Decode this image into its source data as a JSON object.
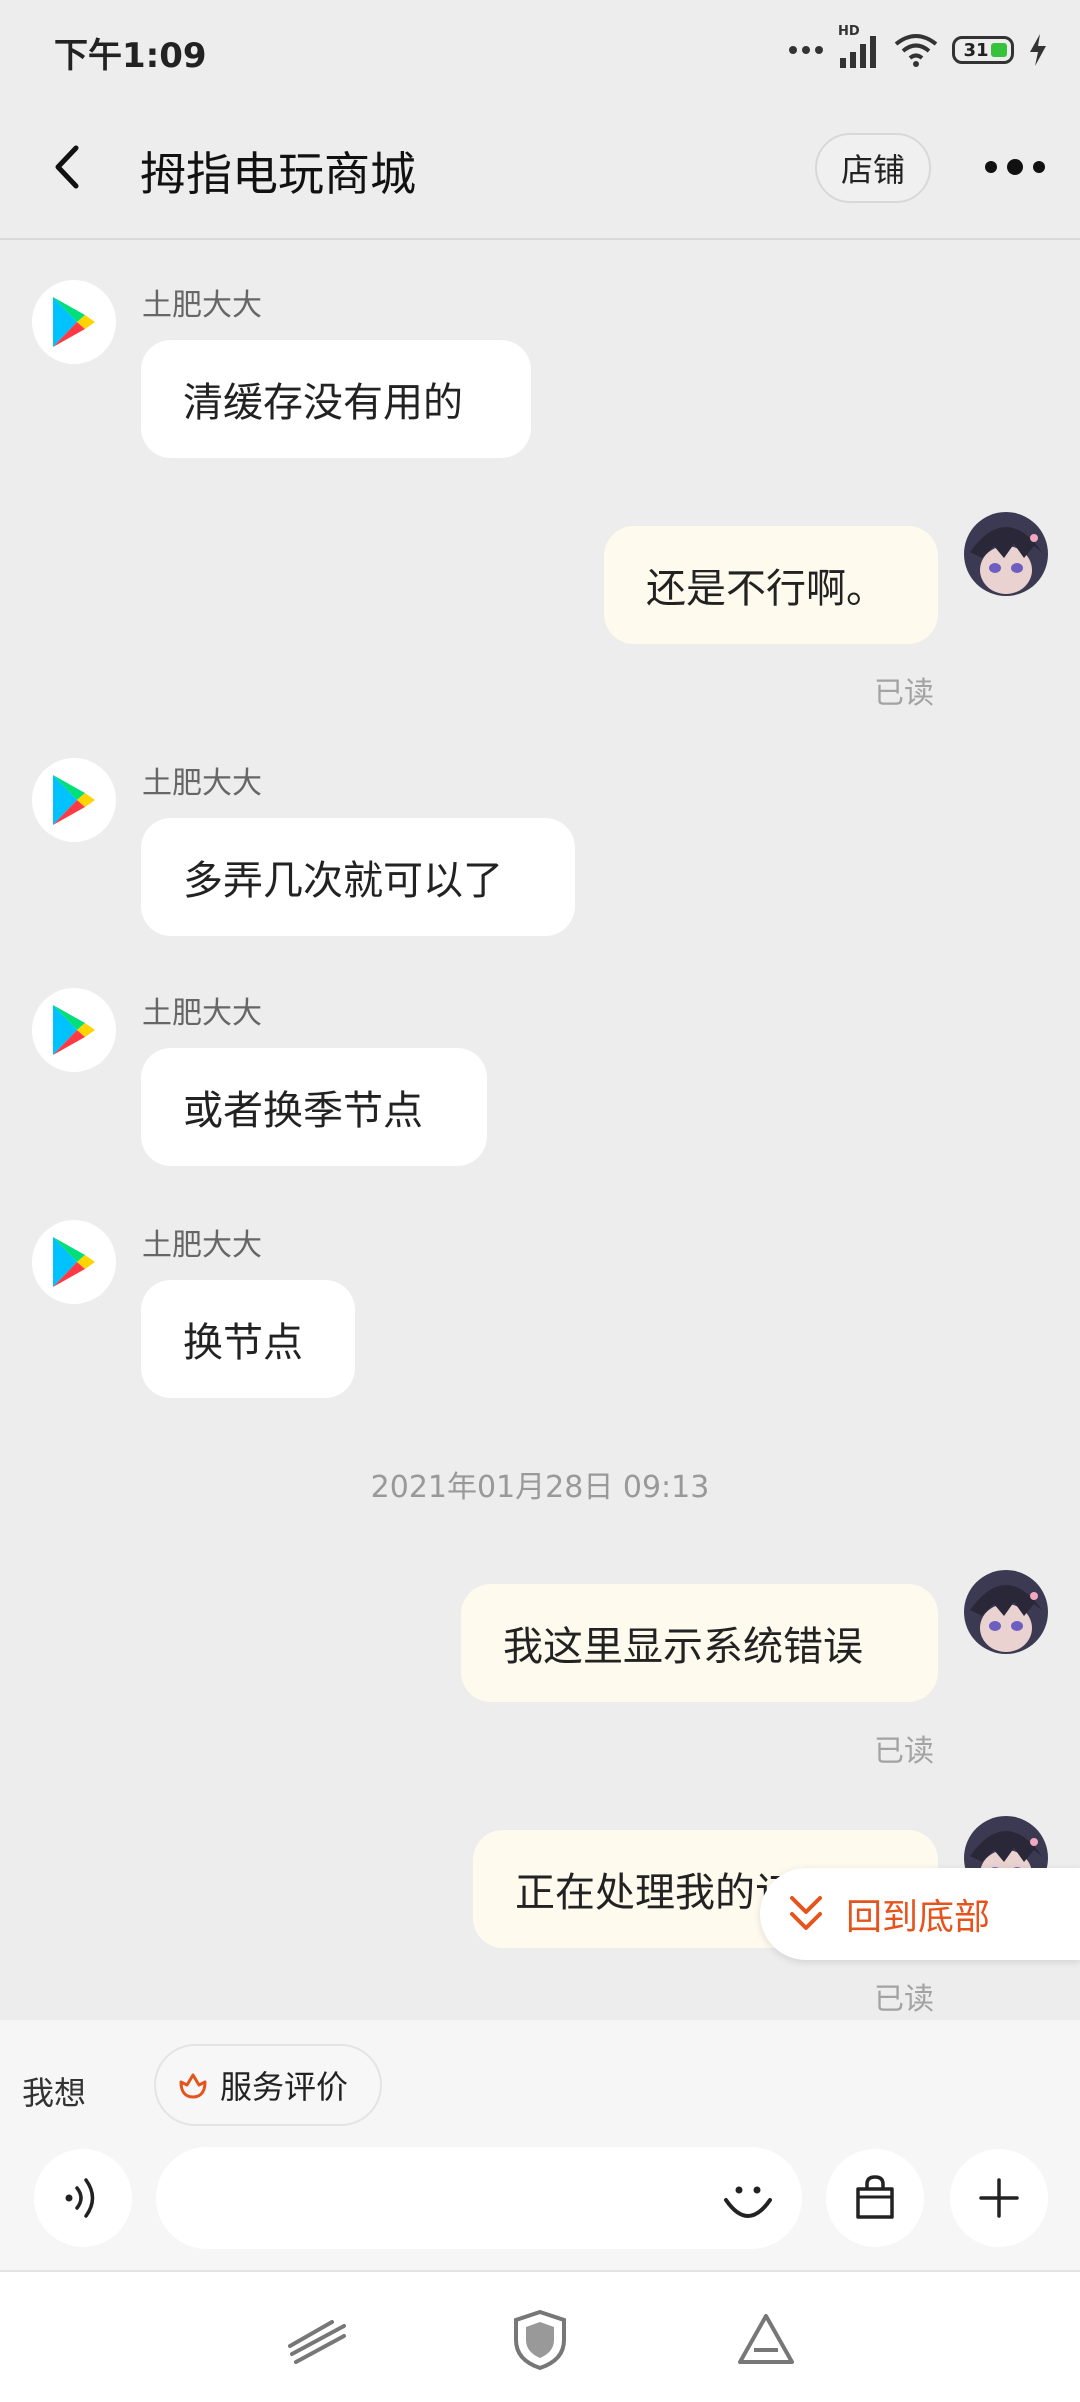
{
  "status_bar": {
    "time": "下午1:09",
    "network_label": "HD",
    "battery_level": "31",
    "icons": [
      "more-dots-icon",
      "signal-icon",
      "wifi-icon",
      "battery-icon",
      "charging-icon"
    ]
  },
  "header": {
    "title": "拇指电玩商城",
    "shop_button": "店铺",
    "icons": [
      "back-arrow-icon",
      "more-options-icon"
    ]
  },
  "messages": [
    {
      "direction": "incoming",
      "sender": "土肥大大",
      "text": "清缓存没有用的"
    },
    {
      "direction": "outgoing",
      "text": "还是不行啊。",
      "status": "已读"
    },
    {
      "direction": "incoming",
      "sender": "土肥大大",
      "text": "多弄几次就可以了"
    },
    {
      "direction": "incoming",
      "sender": "土肥大大",
      "text": "或者换季节点"
    },
    {
      "direction": "incoming",
      "sender": "土肥大大",
      "text": "换节点"
    },
    {
      "direction": "outgoing",
      "text": "我这里显示系统错误",
      "status": "已读"
    },
    {
      "direction": "outgoing",
      "text": "正在处理我的订单",
      "status": "已读"
    }
  ],
  "timestamp": "2021年01月28日 09:13",
  "back_to_bottom": "回到底部",
  "suggestions": {
    "label": "我想",
    "chips": [
      "服务评价"
    ]
  },
  "input": {
    "placeholder": "",
    "icons": [
      "voice-icon",
      "emoji-icon",
      "shopping-bag-icon",
      "plus-icon"
    ]
  },
  "navbar_icons": [
    "nav-slash-icon",
    "nav-shield-icon",
    "nav-triangle-icon"
  ],
  "colors": {
    "accent": "#e5541c",
    "incoming_bubble": "#ffffff",
    "outgoing_bubble": "#fefaee",
    "background": "#ededed"
  }
}
